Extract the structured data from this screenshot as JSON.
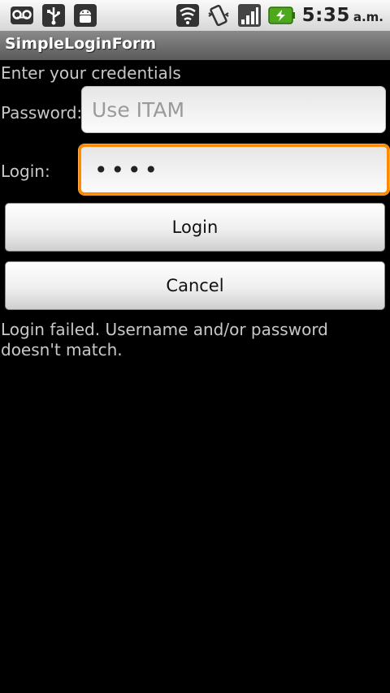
{
  "status_bar": {
    "icons": [
      "voicemail-icon",
      "usb-icon",
      "android-debug-icon",
      "wifi-icon",
      "vibrate-icon",
      "signal-icon",
      "battery-charging-icon"
    ],
    "time": "5:35",
    "ampm": "a.m."
  },
  "app": {
    "title": "SimpleLoginForm"
  },
  "form": {
    "heading": "Enter your credentials",
    "password_label": "Password:",
    "password_placeholder": "Use ITAM",
    "login_label": "Login:",
    "login_value": "••••",
    "login_button": "Login",
    "cancel_button": "Cancel",
    "error_message": "Login failed. Username and/or password doesn't match."
  },
  "colors": {
    "focus": "#ff8a00",
    "text": "#c8c8c8",
    "background": "#000000"
  }
}
